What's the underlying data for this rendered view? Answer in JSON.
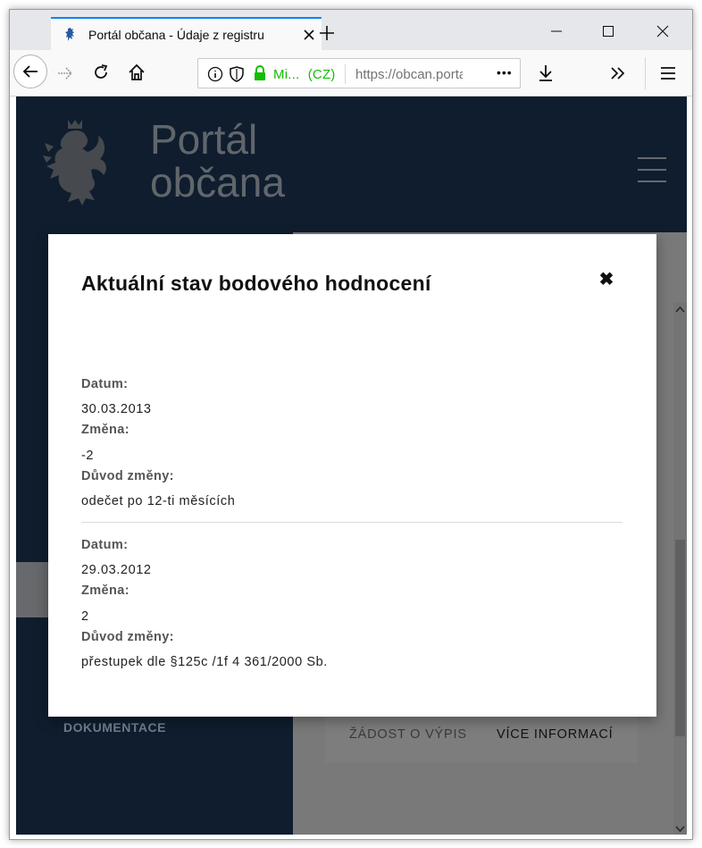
{
  "browser": {
    "tab_title": "Portál občana - Údaje z registru",
    "identity": "Mi...",
    "country": "(CZ)",
    "url": "https://obcan.portal.gov.cz",
    "more_label": "•••"
  },
  "site": {
    "title_line1": "Portál",
    "title_line2": "občana",
    "sidebar_item": "DOKUMENTACE",
    "actions": {
      "request_label": "ŽÁDOST O VÝPIS",
      "info_label": "VÍCE INFORMACÍ"
    }
  },
  "modal": {
    "title": "Aktuální stav bodového hodnocení",
    "close_symbol": "✖",
    "entries": [
      {
        "date_label": "Datum:",
        "date": "30.03.2013",
        "change_label": "Změna:",
        "change": "-2",
        "reason_label": "Důvod změny:",
        "reason": "odečet po 12-ti měsících"
      },
      {
        "date_label": "Datum:",
        "date": "29.03.2012",
        "change_label": "Změna:",
        "change": "2",
        "reason_label": "Důvod změny:",
        "reason": "přestupek dle §125c /1f 4 361/2000 Sb."
      }
    ]
  },
  "colors": {
    "header_blue": "#1e3a5c",
    "secure_green": "#12bc00",
    "tab_accent": "#0a84ff"
  }
}
